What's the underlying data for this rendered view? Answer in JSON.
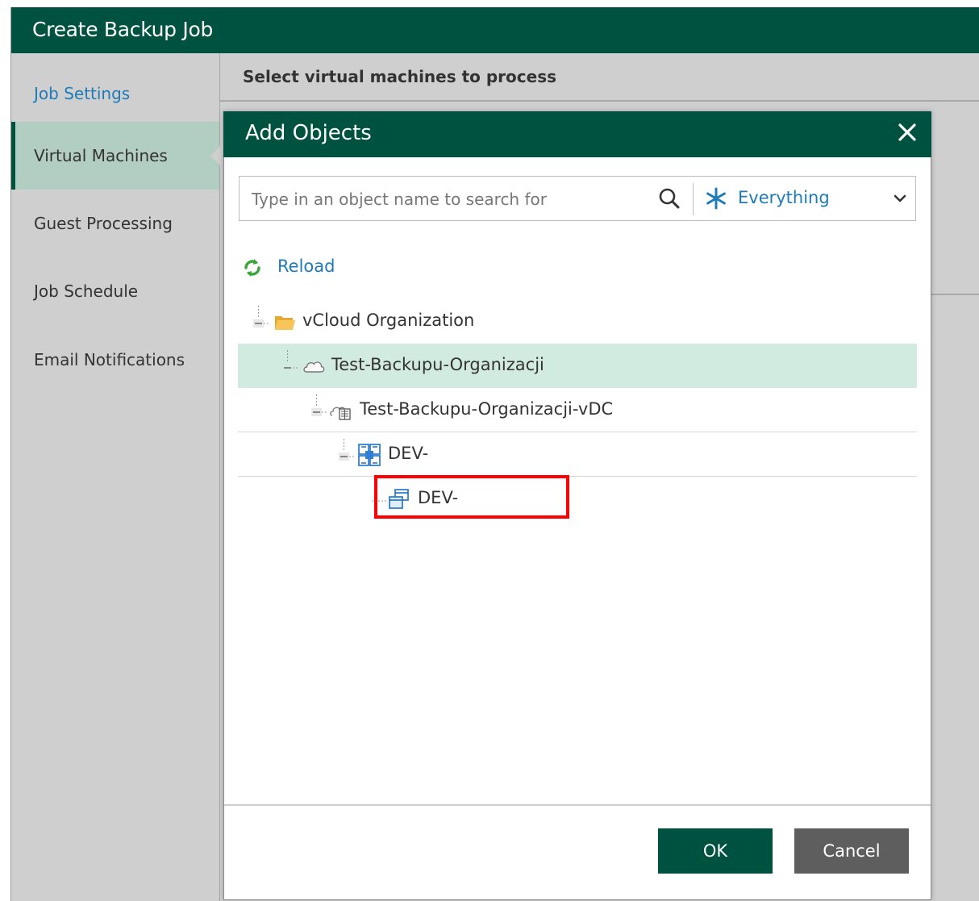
{
  "wizard": {
    "title": "Create Backup Job",
    "subtitle": "Select virtual machines to process",
    "steps": [
      {
        "label": "Job Settings"
      },
      {
        "label": "Virtual Machines"
      },
      {
        "label": "Guest Processing"
      },
      {
        "label": "Job Schedule"
      },
      {
        "label": "Email Notifications"
      }
    ],
    "active_step": "Virtual Machines"
  },
  "dialog": {
    "title": "Add Objects",
    "close_glyph": "✕",
    "search": {
      "value": "",
      "placeholder": "Type in an object name to search for",
      "filter_label": "Everything"
    },
    "reload_label": "Reload",
    "tree": [
      {
        "label": "vCloud Organization",
        "icon": "folder-icon",
        "level": 0,
        "expanded": true
      },
      {
        "label": "Test-Backupu-Organizacji",
        "icon": "cloud-icon",
        "level": 1,
        "expanded": true,
        "selected": true
      },
      {
        "label": "Test-Backupu-Organizacji-vDC",
        "icon": "vdc-icon",
        "level": 2,
        "expanded": true
      },
      {
        "label": "DEV-",
        "icon": "vapp-icon",
        "level": 3,
        "expanded": true
      },
      {
        "label": "DEV-",
        "icon": "vm-icon",
        "level": 4
      }
    ],
    "buttons": {
      "ok": "OK",
      "cancel": "Cancel"
    }
  },
  "colors": {
    "header_green": "#005240",
    "link_blue": "#1e7bb8",
    "selected_row": "#d2ebe0",
    "highlight": "#ff0000"
  }
}
